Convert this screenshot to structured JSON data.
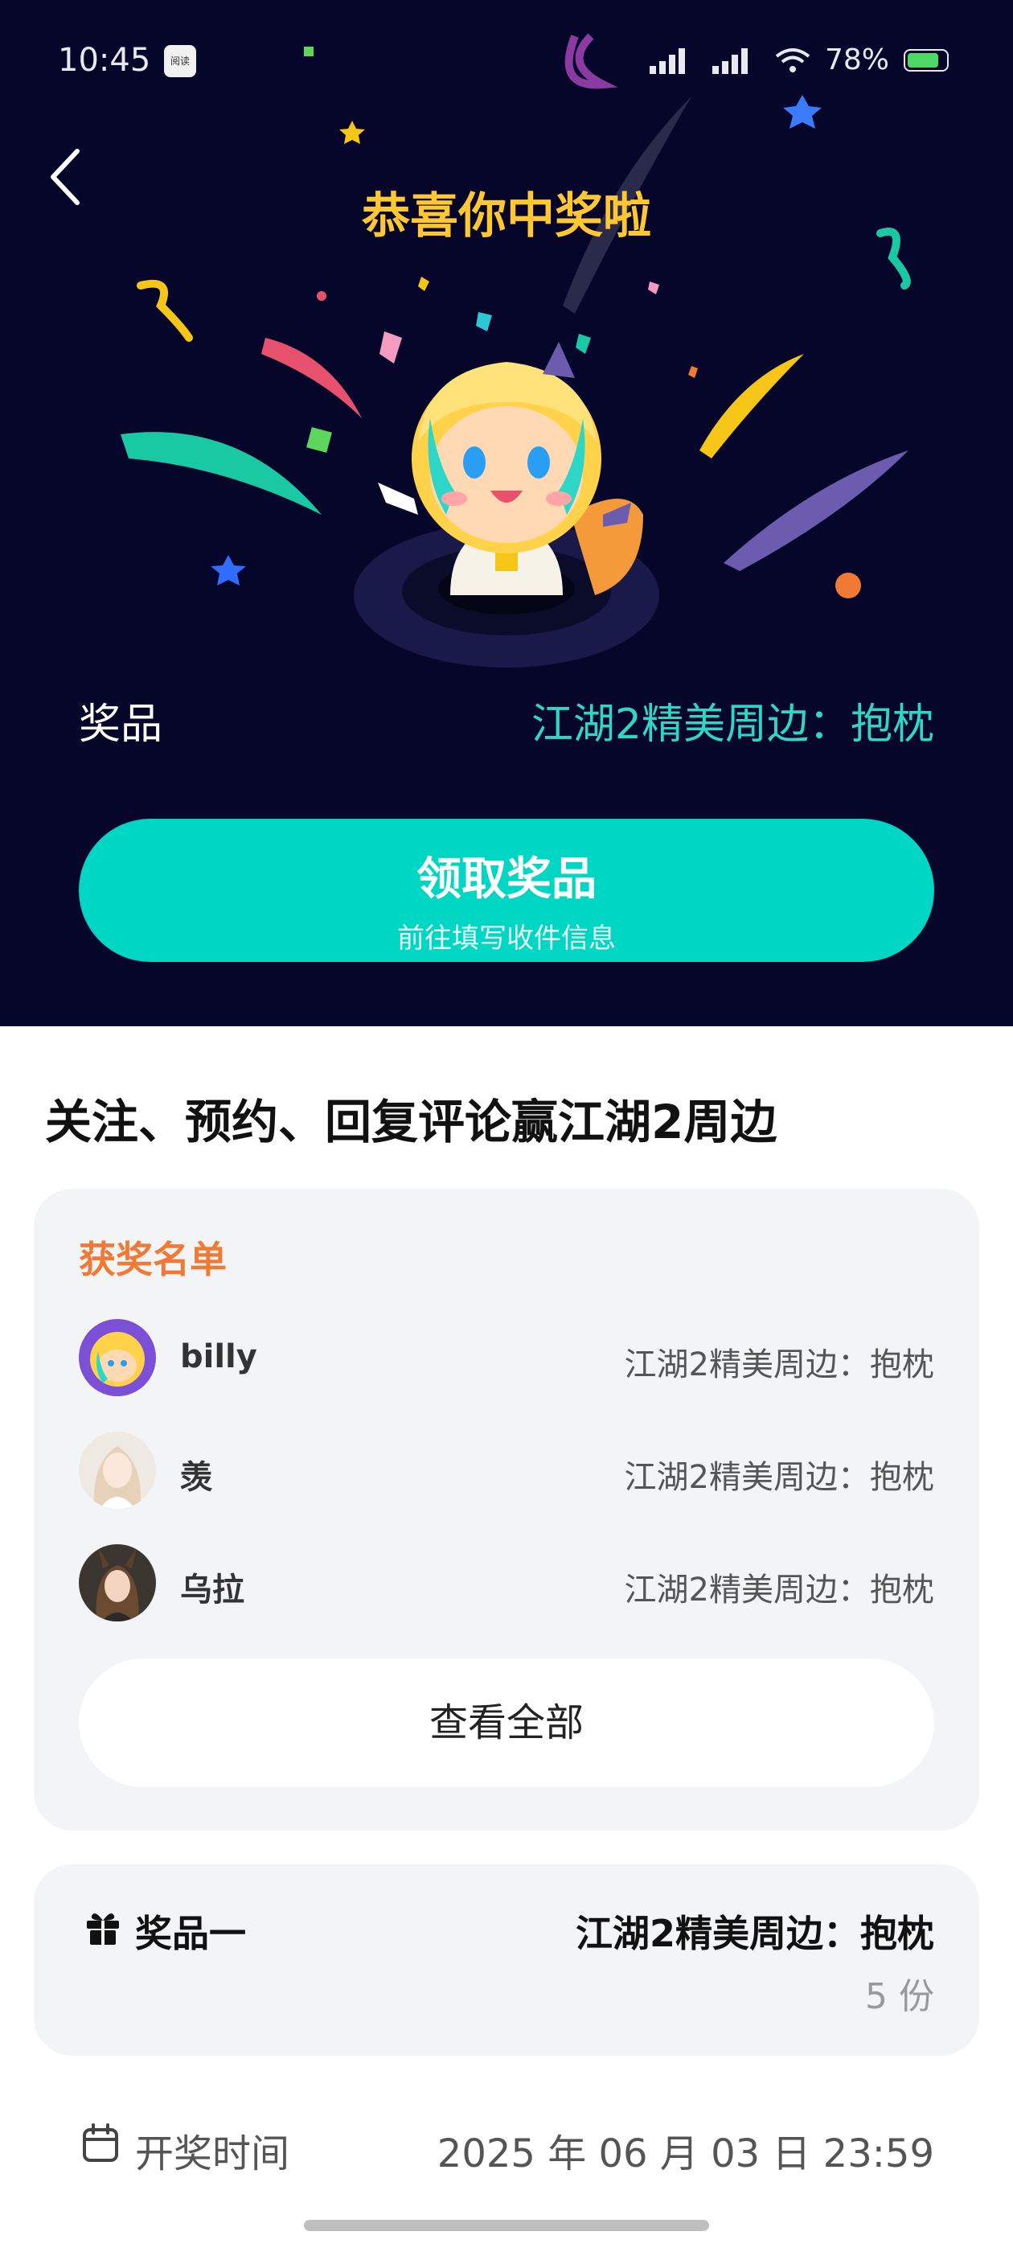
{
  "status_bar": {
    "time": "10:45",
    "app_badge": "阅读",
    "battery": "78%"
  },
  "hero": {
    "title": "恭喜你中奖啦",
    "prize_label": "奖品",
    "prize_value": "江湖2精美周边：抱枕",
    "claim_button": {
      "label": "领取奖品",
      "sublabel": "前往填写收件信息"
    }
  },
  "event": {
    "title": "关注、预约、回复评论赢江湖2周边"
  },
  "winners": {
    "title": "获奖名单",
    "items": [
      {
        "name": "billy",
        "prize": "江湖2精美周边：抱枕"
      },
      {
        "name": "羡",
        "prize": "江湖2精美周边：抱枕"
      },
      {
        "name": "乌拉",
        "prize": "江湖2精美周边：抱枕"
      }
    ],
    "view_all": "查看全部"
  },
  "prize_info": {
    "tier": "奖品一",
    "name": "江湖2精美周边：抱枕",
    "quantity": "5 份"
  },
  "draw_time": {
    "label": "开奖时间",
    "value": "2025 年 06 月 03 日 23:59"
  },
  "colors": {
    "hero_bg": "#06052a",
    "accent": "#00d6c4",
    "title_gold": "#ffc832",
    "winners_title": "#f07a35"
  }
}
